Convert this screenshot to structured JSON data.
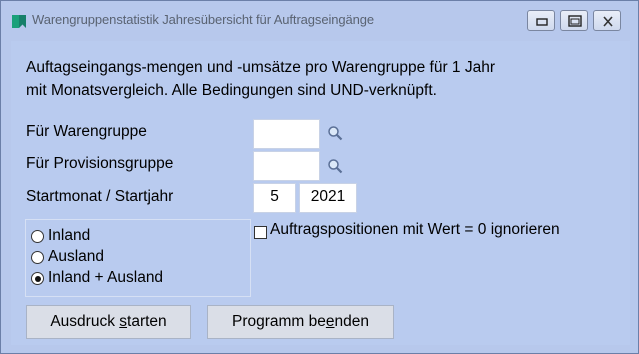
{
  "window": {
    "title": "Warengruppenstatistik Jahresübersicht für Auftragseingänge",
    "icon": "bookmark-icon",
    "controls": [
      "minimize-icon",
      "maximize-icon",
      "close-icon"
    ]
  },
  "description": {
    "line1": "Auftagseingangs-mengen und -umsätze pro Warengruppe für 1 Jahr",
    "line2": "mit Monatsvergleich. Alle Bedingungen sind UND-verknüpft."
  },
  "form": {
    "warengruppe": {
      "label": "Für Warengruppe",
      "value": "",
      "lookup_icon": "magnifier-icon"
    },
    "provisionsgruppe": {
      "label": "Für Provisionsgruppe",
      "value": "",
      "lookup_icon": "magnifier-icon"
    },
    "start": {
      "label": "Startmonat / Startjahr",
      "month": "5",
      "year": "2021"
    }
  },
  "region": {
    "options": [
      {
        "label": "Inland",
        "selected": false
      },
      {
        "label": "Ausland",
        "selected": false
      },
      {
        "label": "Inland + Ausland",
        "selected": true
      }
    ]
  },
  "ignore_zero": {
    "label": "Auftragspositionen mit Wert = 0 ignorieren",
    "checked": false
  },
  "buttons": {
    "print": {
      "pre": "Ausdruck ",
      "mnemonic": "s",
      "post": "tarten"
    },
    "exit": {
      "pre": "Programm be",
      "mnemonic": "e",
      "post": "nden"
    }
  },
  "colors": {
    "window_bg": "#b9cbef",
    "icon_accent": "#1aa07a"
  }
}
